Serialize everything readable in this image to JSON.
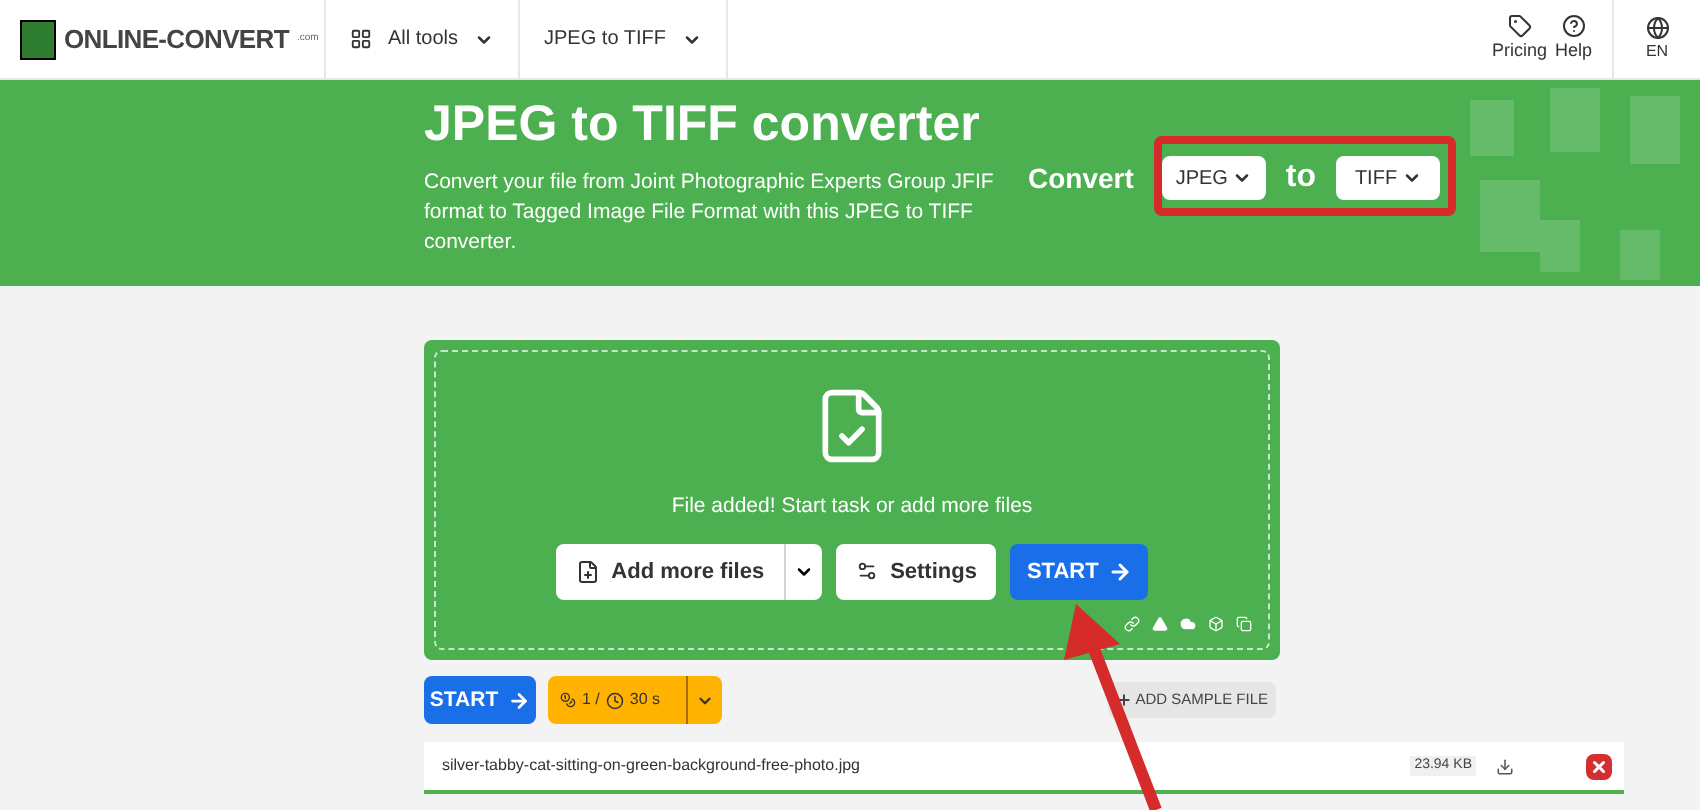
{
  "header": {
    "logo": "ONLINE-CONVERT",
    "logo_suffix": ".com",
    "nav": [
      {
        "label": "All tools",
        "kind": "grid"
      },
      {
        "label": "JPEG to TIFF",
        "kind": "plain"
      }
    ],
    "actions": [
      {
        "label": "Pricing",
        "kind": "tag"
      },
      {
        "label": "Help",
        "kind": "help"
      }
    ],
    "language": "EN"
  },
  "banner": {
    "title": "JPEG to TIFF converter",
    "description": "Convert your file from Joint Photographic Experts Group JFIF format to Tagged Image File Format with this JPEG to TIFF converter.",
    "convert_label": "Convert",
    "from": "JPEG",
    "to_word": "to",
    "to": "TIFF"
  },
  "dropzone": {
    "message": "File added! Start task or add more files",
    "add_button": "Add more files",
    "settings_button": "Settings",
    "start_button": "START"
  },
  "toolbar": {
    "start_button": "START",
    "credits": "1 /",
    "duration": "30 s",
    "sample_button": "ADD SAMPLE FILE"
  },
  "file": {
    "name": "silver-tabby-cat-sitting-on-green-background-free-photo.jpg",
    "size": "23.94 KB"
  },
  "annotations": {
    "highlight_frame": true,
    "arrow": true
  }
}
